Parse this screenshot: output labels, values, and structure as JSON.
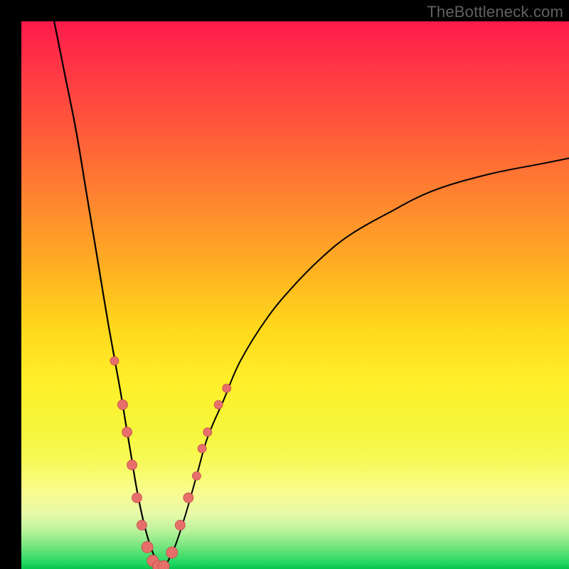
{
  "watermark": "TheBottleneck.com",
  "chart_data": {
    "type": "line",
    "title": "",
    "xlabel": "",
    "ylabel": "",
    "xlim": [
      0,
      100
    ],
    "ylim": [
      0,
      100
    ],
    "grid": false,
    "notes": "Two black curves over a vertical red→green gradient. Left curve descends steeply from top-left into a trough around x≈25 near y≈0, right curve rises from the trough toward the upper right, asymptotically flattening. Salmon-colored markers cluster along both curves in the lower band (roughly y ≤ 30).",
    "series": [
      {
        "name": "left_curve",
        "x": [
          6,
          8,
          10,
          12,
          14,
          16,
          18,
          19,
          20,
          21,
          22,
          23,
          24,
          25,
          26
        ],
        "y": [
          100,
          90,
          80,
          68,
          56,
          44,
          33,
          27,
          21,
          15,
          10,
          6,
          3,
          1,
          0
        ]
      },
      {
        "name": "right_curve",
        "x": [
          26,
          28,
          30,
          32,
          34,
          37,
          40,
          45,
          50,
          55,
          60,
          67,
          75,
          85,
          95,
          100
        ],
        "y": [
          0,
          4,
          10,
          17,
          24,
          31,
          38,
          46,
          52,
          57,
          61,
          65,
          69,
          72,
          74,
          75
        ]
      }
    ],
    "markers": [
      {
        "x": 17.0,
        "y": 38,
        "r": 6
      },
      {
        "x": 18.5,
        "y": 30,
        "r": 7
      },
      {
        "x": 19.3,
        "y": 25,
        "r": 7
      },
      {
        "x": 20.2,
        "y": 19,
        "r": 7
      },
      {
        "x": 21.1,
        "y": 13,
        "r": 7
      },
      {
        "x": 22.0,
        "y": 8,
        "r": 7
      },
      {
        "x": 23.0,
        "y": 4,
        "r": 8
      },
      {
        "x": 24.0,
        "y": 1.5,
        "r": 8
      },
      {
        "x": 25.0,
        "y": 0.5,
        "r": 8
      },
      {
        "x": 26.0,
        "y": 0.5,
        "r": 8
      },
      {
        "x": 27.5,
        "y": 3,
        "r": 8
      },
      {
        "x": 29.0,
        "y": 8,
        "r": 7
      },
      {
        "x": 30.5,
        "y": 13,
        "r": 7
      },
      {
        "x": 32.0,
        "y": 17,
        "r": 6
      },
      {
        "x": 33.0,
        "y": 22,
        "r": 6
      },
      {
        "x": 34.0,
        "y": 25,
        "r": 6
      },
      {
        "x": 36.0,
        "y": 30,
        "r": 6
      },
      {
        "x": 37.5,
        "y": 33,
        "r": 6
      }
    ]
  }
}
